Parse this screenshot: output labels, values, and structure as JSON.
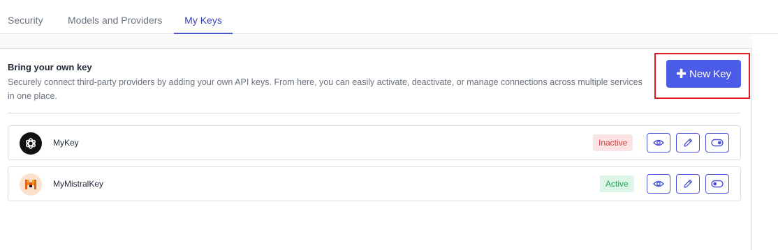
{
  "tabs": [
    {
      "label": "Security"
    },
    {
      "label": "Models and Providers"
    },
    {
      "label": "My Keys",
      "active": true
    }
  ],
  "section": {
    "title": "Bring your own key",
    "description": "Securely connect third-party providers by adding your own API keys. From here, you can easily activate, deactivate, or manage connections across multiple services in one place."
  },
  "new_key_button": {
    "label": "New Key",
    "icon": "plus-icon"
  },
  "keys": [
    {
      "name": "MyKey",
      "provider_icon": "openai-logo-icon",
      "status": "Inactive"
    },
    {
      "name": "MyMistralKey",
      "provider_icon": "mistral-logo-icon",
      "status": "Active"
    }
  ],
  "row_actions": [
    "eye-icon",
    "pencil-icon",
    "toggle-icon"
  ],
  "colors": {
    "accent": "#4b5ce8",
    "tab_active": "#3b44b8",
    "highlight": "#e01b24",
    "inactive_bg": "#fde4e4",
    "inactive_text": "#d23a3a",
    "active_bg": "#dcf5e6",
    "active_text": "#22a05a"
  }
}
